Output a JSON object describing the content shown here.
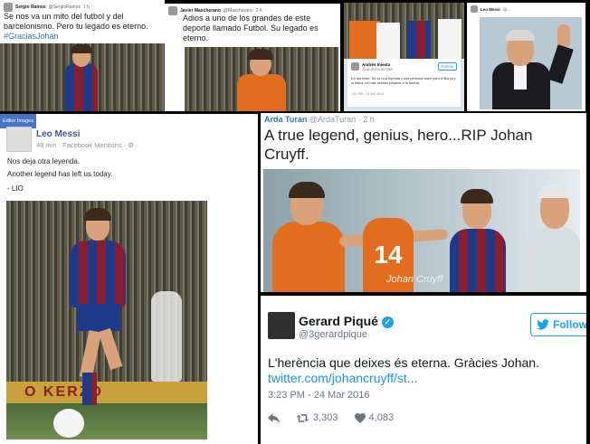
{
  "tile_sergio": {
    "name": "Sergio Ramos",
    "handle": "@SergioRamos",
    "time": "1 h",
    "text_line1": "Se nos va un mito del futbol y del",
    "text_line2": "barcelonismo. Pero tu legado es eterno.",
    "hashtag": "#GraciasJohan"
  },
  "tile_mascherano": {
    "name": "Javier Mascherano",
    "handle": "@Mascherano",
    "time": "2 h",
    "text_line1": "Adios a uno de los grandes de este",
    "text_line2": "deporte llamado Futbol. Su legado es",
    "text_line3": "eterno."
  },
  "tile_iniesta": {
    "name": "Andrés Iniesta",
    "handle": "@andresiniesta8",
    "follow_label": "Follow",
    "text": "Un día triste. Se va una leyenda y una persona clave para el Barça y el fútbol. Mi más sentido pésame a la familia.",
    "meta": "1:51 PM - 24 Mar 2016"
  },
  "tile_leo": {
    "badge": "Editor Images",
    "name": "Leo Messi",
    "meta": "48 min · Facebook Mentions · ⚙",
    "line1": "Nos deja otra leyenda.",
    "line2": "Another legend has left us today.",
    "line3": "- LIO",
    "photo_banner": "O KERZO"
  },
  "tile_arda": {
    "name": "Arda Turan",
    "handle": "@ArdaTuran",
    "time": "· 2 h",
    "text": "A true legend, genius, hero...RIP Johan Cruyff.",
    "watermark": "Johan Cruyff",
    "shirt_number": "14"
  },
  "tile_pique": {
    "name": "Gerard Piqué",
    "handle": "@3gerardpique",
    "follow_label": "Follow",
    "text": "L'herència que deixes és eterna. Gràcies Johan.",
    "link": "twitter.com/johancruyff/st...",
    "time": "3:23 PM - 24 Mar 2016",
    "retweets": "3,303",
    "likes": "4,083"
  },
  "tile_top_right": {
    "name": "Leo Messi",
    "handle": "@..."
  },
  "colors": {
    "twitter_blue": "#1da1f2",
    "facebook_blue": "#3b5998",
    "barca_blue": "#1e3a8a",
    "barca_red": "#8b1e2e",
    "holland_orange": "#e36d1f"
  }
}
